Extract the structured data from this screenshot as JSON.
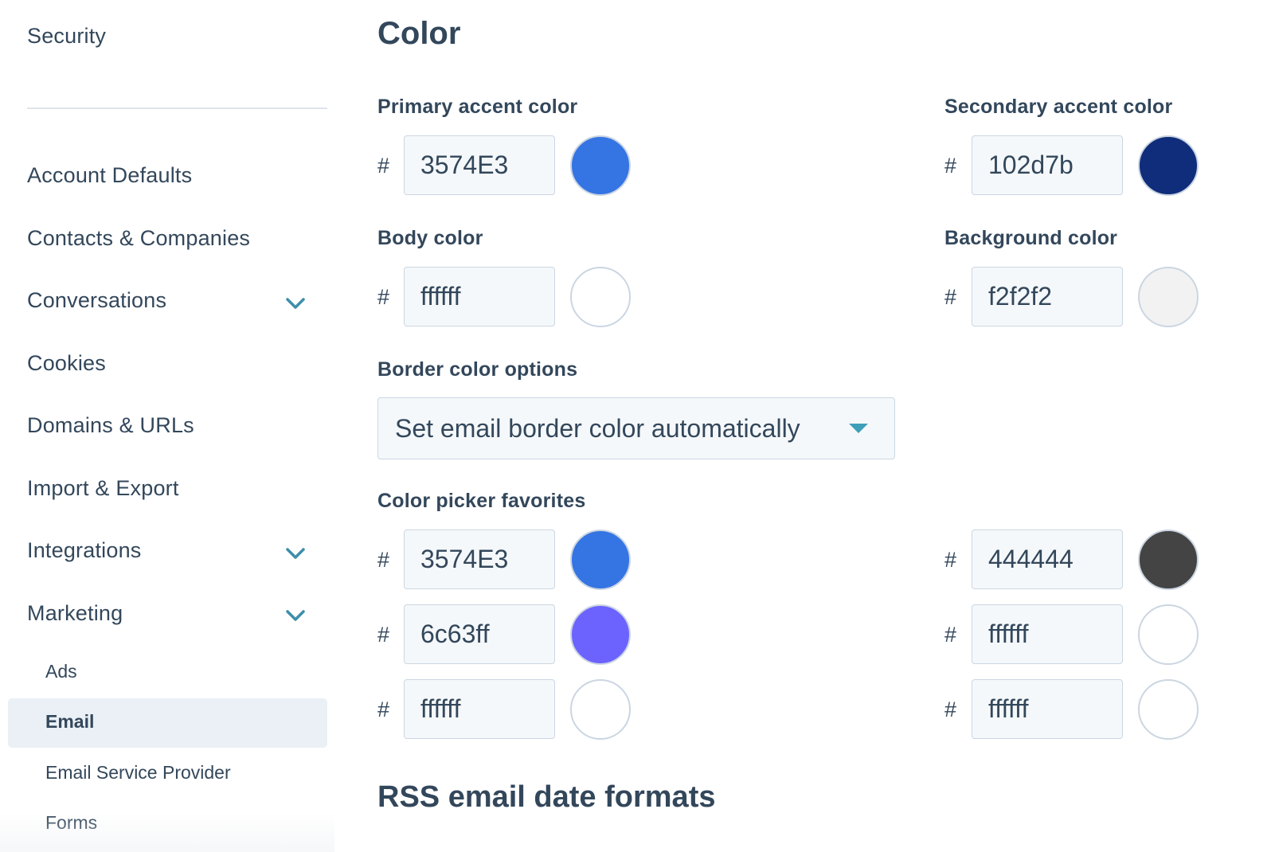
{
  "sidebar": {
    "top_item": "Security",
    "items": [
      {
        "label": "Account Defaults",
        "expandable": false
      },
      {
        "label": "Contacts & Companies",
        "expandable": false
      },
      {
        "label": "Conversations",
        "expandable": true
      },
      {
        "label": "Cookies",
        "expandable": false
      },
      {
        "label": "Domains & URLs",
        "expandable": false
      },
      {
        "label": "Import & Export",
        "expandable": false
      },
      {
        "label": "Integrations",
        "expandable": true
      },
      {
        "label": "Marketing",
        "expandable": true,
        "expanded": true
      }
    ],
    "sub_items": [
      {
        "label": "Ads",
        "active": false
      },
      {
        "label": "Email",
        "active": true
      },
      {
        "label": "Email Service Provider",
        "active": false
      },
      {
        "label": "Forms",
        "active": false
      }
    ]
  },
  "main": {
    "section_title": "Color",
    "hash_symbol": "#",
    "primary": {
      "label": "Primary accent color",
      "value": "3574E3",
      "swatch": "#3574E3"
    },
    "secondary": {
      "label": "Secondary accent color",
      "value": "102d7b",
      "swatch": "#102d7b"
    },
    "body": {
      "label": "Body color",
      "value": "ffffff",
      "swatch": "#ffffff"
    },
    "background": {
      "label": "Background color",
      "value": "f2f2f2",
      "swatch": "#f2f2f2"
    },
    "border": {
      "label": "Border color options",
      "selected": "Set email border color automatically"
    },
    "favorites": {
      "label": "Color picker favorites",
      "left": [
        {
          "value": "3574E3",
          "swatch": "#3574E3"
        },
        {
          "value": "6c63ff",
          "swatch": "#6c63ff"
        },
        {
          "value": "ffffff",
          "swatch": "#ffffff"
        }
      ],
      "right": [
        {
          "value": "444444",
          "swatch": "#444444"
        },
        {
          "value": "ffffff",
          "swatch": "#ffffff"
        },
        {
          "value": "ffffff",
          "swatch": "#ffffff"
        }
      ]
    },
    "next_section_title": "RSS email date formats"
  }
}
